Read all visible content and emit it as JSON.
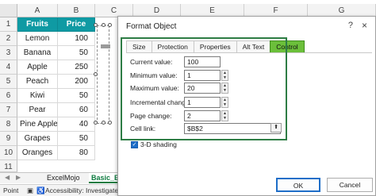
{
  "spreadsheet": {
    "columns": [
      "A",
      "B",
      "C",
      "D",
      "E",
      "F",
      "G"
    ],
    "rows": [
      "1",
      "2",
      "3",
      "4",
      "5",
      "6",
      "7",
      "8",
      "9",
      "10",
      "11"
    ],
    "header": {
      "fruits": "Fruits",
      "price": "Price"
    },
    "data": [
      {
        "fruit": "Lemon",
        "price": "100"
      },
      {
        "fruit": "Banana",
        "price": "50"
      },
      {
        "fruit": "Apple",
        "price": "250"
      },
      {
        "fruit": "Peach",
        "price": "200"
      },
      {
        "fruit": "Kiwi",
        "price": "50"
      },
      {
        "fruit": "Pear",
        "price": "60"
      },
      {
        "fruit": "Pine Apple",
        "price": "40"
      },
      {
        "fruit": "Grapes",
        "price": "50"
      },
      {
        "fruit": "Oranges",
        "price": "80"
      }
    ],
    "header_color": "#0f9aa3"
  },
  "sheet_tabs": {
    "tab1": "ExcelMojo",
    "tab2": "Basic_Exa"
  },
  "status_bar": {
    "mode": "Point",
    "accessibility": "Accessibility: Investigate"
  },
  "dialog": {
    "title": "Format Object",
    "help": "?",
    "close": "×",
    "tabs": [
      "Size",
      "Protection",
      "Properties",
      "Alt Text",
      "Control"
    ],
    "active_tab": "Control",
    "fields": {
      "current_value": {
        "label": "Current value:",
        "value": "100"
      },
      "minimum_value": {
        "label": "Minimum value:",
        "value": "1"
      },
      "maximum_value": {
        "label": "Maximum value:",
        "value": "20"
      },
      "incremental_change": {
        "label": "Incremental change:",
        "value": "1"
      },
      "page_change": {
        "label": "Page change:",
        "value": "2"
      },
      "cell_link": {
        "label": "Cell link:",
        "value": "$B$2"
      }
    },
    "shading": {
      "label": "3-D shading",
      "checked": true
    },
    "buttons": {
      "ok": "OK",
      "cancel": "Cancel"
    },
    "accent_color": "#2e7d45",
    "active_tab_color": "#6bbf3a"
  }
}
